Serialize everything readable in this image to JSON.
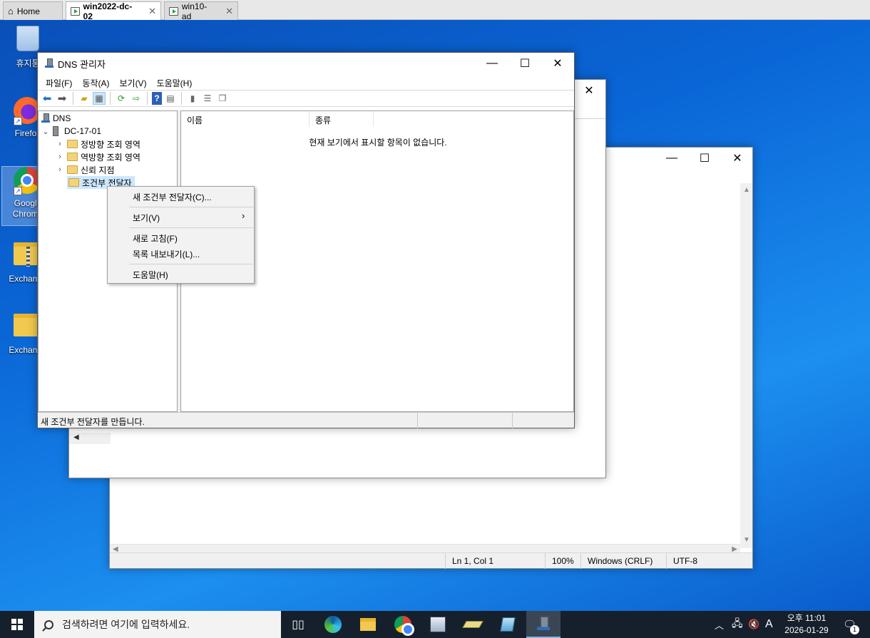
{
  "vm_tabs": [
    {
      "label": "Home"
    },
    {
      "label": "win2022-dc-02",
      "active": true
    },
    {
      "label": "win10-ad"
    }
  ],
  "desktop_icons": [
    {
      "label": "휴지통",
      "icon": "recycle-bin-icon"
    },
    {
      "label": "Firefox",
      "icon": "firefox-icon"
    },
    {
      "label": "Google Chrome",
      "icon": "chrome-icon"
    },
    {
      "label": "Exchange",
      "icon": "zip-folder-icon"
    },
    {
      "label": "Exchange",
      "icon": "folder-icon"
    }
  ],
  "notepad": {
    "status": {
      "position": "Ln 1, Col 1",
      "zoom": "100%",
      "line_ending": "Windows (CRLF)",
      "encoding": "UTF-8"
    }
  },
  "dns": {
    "title": "DNS 관리자",
    "menu": [
      "파일(F)",
      "동작(A)",
      "보기(V)",
      "도움말(H)"
    ],
    "tree": {
      "root": "DNS",
      "server": "DC-17-01",
      "children": [
        "정방향 조회 영역",
        "역방향 조회 영역",
        "신뢰 지점",
        "조건부 전달자"
      ]
    },
    "columns": [
      "이름",
      "종류"
    ],
    "empty_message": "현재 보기에서 표시할 항목이 없습니다.",
    "status_text": "새 조건부 전달자를 만듭니다."
  },
  "context_menu": {
    "items": [
      "새 조건부 전달자(C)...",
      "보기(V)",
      "새로 고침(F)",
      "목록 내보내기(L)...",
      "도움말(H)"
    ]
  },
  "taskbar": {
    "search_placeholder": "검색하려면 여기에 입력하세요.",
    "ime": "A",
    "time": "오후 11:01",
    "date": "2026-01-29",
    "notification_count": "1"
  },
  "colors": {
    "accent": "#0078d7",
    "selection": "#cce8ff",
    "taskbar": "#16202c"
  }
}
